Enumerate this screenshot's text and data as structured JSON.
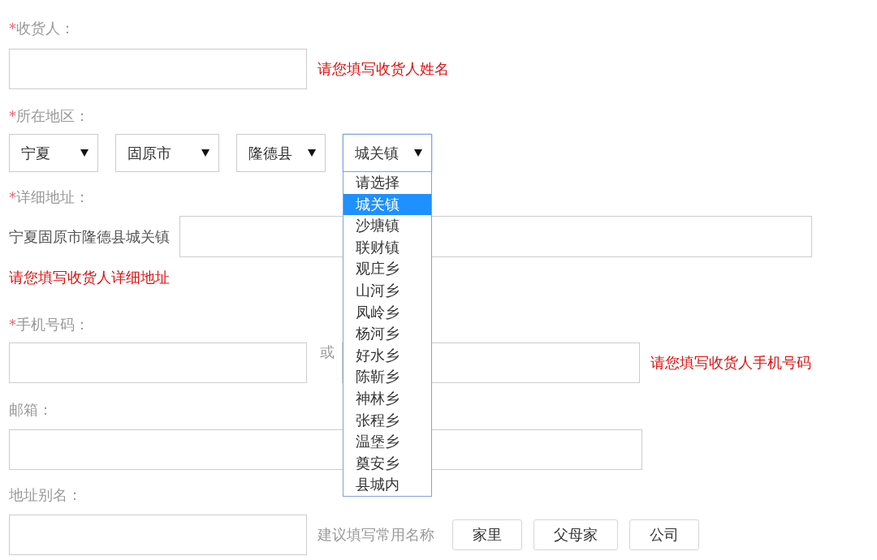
{
  "consignee": {
    "mark": "*",
    "label": "收货人：",
    "error": "请您填写收货人姓名"
  },
  "region": {
    "mark": "*",
    "label": "所在地区：",
    "selects": [
      {
        "value": "宁夏",
        "expanded": false
      },
      {
        "value": "固原市",
        "expanded": false
      },
      {
        "value": "隆德县",
        "expanded": false
      },
      {
        "value": "城关镇",
        "expanded": true,
        "options": [
          {
            "label": "请选择",
            "selected": false
          },
          {
            "label": "城关镇",
            "selected": true
          },
          {
            "label": "沙塘镇",
            "selected": false
          },
          {
            "label": "联财镇",
            "selected": false
          },
          {
            "label": "观庄乡",
            "selected": false
          },
          {
            "label": "山河乡",
            "selected": false
          },
          {
            "label": "凤岭乡",
            "selected": false
          },
          {
            "label": "杨河乡",
            "selected": false
          },
          {
            "label": "好水乡",
            "selected": false
          },
          {
            "label": "陈靳乡",
            "selected": false
          },
          {
            "label": "神林乡",
            "selected": false
          },
          {
            "label": "张程乡",
            "selected": false
          },
          {
            "label": "温堡乡",
            "selected": false
          },
          {
            "label": "奠安乡",
            "selected": false
          },
          {
            "label": "县城内",
            "selected": false
          }
        ]
      }
    ]
  },
  "address": {
    "mark": "*",
    "label": "详细地址：",
    "prefix": "宁夏固原市隆德县城关镇",
    "error": "请您填写收货人详细地址"
  },
  "phone": {
    "mark": "*",
    "label": "手机号码：",
    "separator": "或",
    "error": "请您填写收货人手机号码"
  },
  "email": {
    "label": "邮箱："
  },
  "alias": {
    "label": "地址别名：",
    "hint": "建议填写常用名称",
    "presets": [
      "家里",
      "父母家",
      "公司"
    ]
  }
}
